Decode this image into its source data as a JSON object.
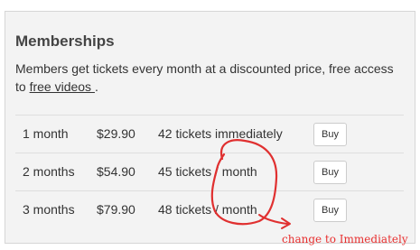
{
  "panel": {
    "title": "Memberships",
    "description_text": "Members get tickets every month at a discounted price, free access to ",
    "description_link": "free videos ",
    "description_end": "."
  },
  "plans": [
    {
      "period": "1 month",
      "price": "$29.90",
      "tickets": "42 tickets immediately",
      "buy_label": "Buy"
    },
    {
      "period": "2 months",
      "price": "$54.90",
      "tickets": "45 tickets / month",
      "buy_label": "Buy"
    },
    {
      "period": "3 months",
      "price": "$79.90",
      "tickets": "48 tickets / month",
      "buy_label": "Buy"
    }
  ],
  "annotation": {
    "note": "change to Immediately",
    "color": "#e83030"
  },
  "colors": {
    "panel_background": "#f3f3f3",
    "panel_border": "#d6d6d6",
    "divider": "#dedede"
  }
}
